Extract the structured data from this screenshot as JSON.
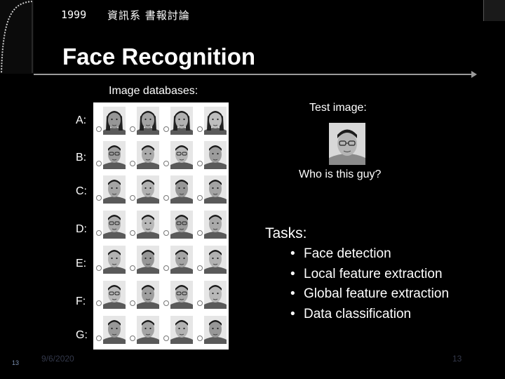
{
  "header": {
    "year": "1999",
    "organization": "資訊系 書報討論"
  },
  "title": "Face Recognition",
  "databases": {
    "heading": "Image databases:",
    "rows": [
      {
        "label": "A:"
      },
      {
        "label": "B:"
      },
      {
        "label": "C:"
      },
      {
        "label": "D:"
      },
      {
        "label": "E:"
      },
      {
        "label": "F:"
      },
      {
        "label": "G:"
      }
    ]
  },
  "test": {
    "heading": "Test image:",
    "question": "Who is this guy?"
  },
  "tasks": {
    "title": "Tasks:",
    "bullet": "•",
    "items": [
      {
        "label": "Face detection"
      },
      {
        "label": "Local feature extraction"
      },
      {
        "label": "Global feature extraction"
      },
      {
        "label": "Data classification"
      }
    ]
  },
  "footer": {
    "slide_number": "13",
    "date": "9/6/2020",
    "page_number": "13"
  },
  "colors": {
    "background": "#000000",
    "text": "#ffffff",
    "rule": "#9a9a9a",
    "footer": "#33384a"
  }
}
